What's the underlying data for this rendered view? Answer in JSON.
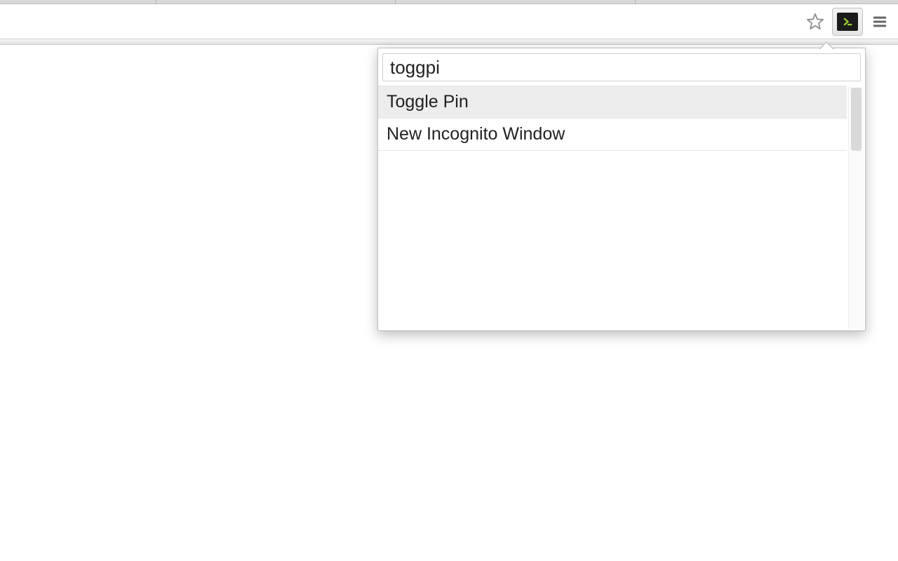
{
  "toolbar": {
    "star_title": "Bookmark this page",
    "extension_title": "Command palette",
    "menu_title": "Customize and control"
  },
  "popup": {
    "input_value": "toggpi",
    "results": [
      {
        "label": "Toggle Pin",
        "selected": true
      },
      {
        "label": "New Incognito Window",
        "selected": false
      }
    ]
  }
}
